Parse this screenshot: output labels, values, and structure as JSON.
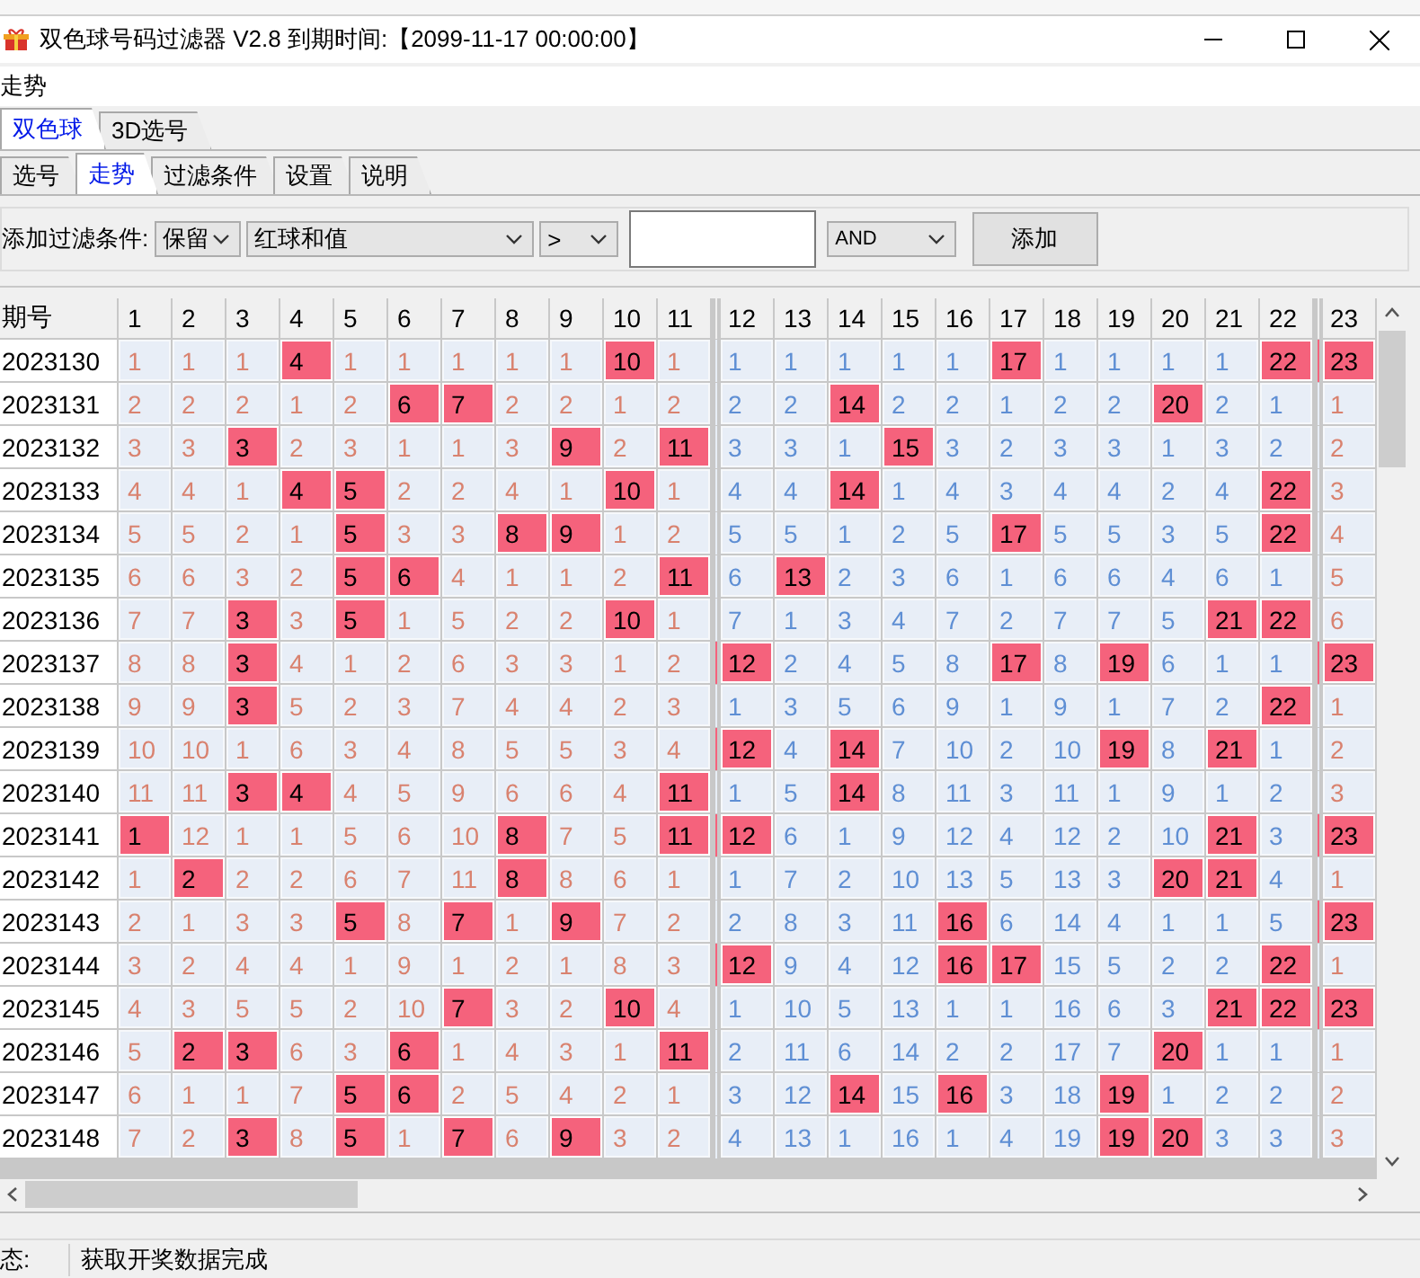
{
  "window": {
    "title": "双色球号码过滤器 V2.8 到期时间:【2099-11-17 00:00:00】"
  },
  "menu": [
    {
      "label": "走势"
    }
  ],
  "top_tabs": [
    {
      "label": "双色球",
      "selected": true
    },
    {
      "label": "3D选号",
      "selected": false
    }
  ],
  "sub_tabs": [
    {
      "label": "选号",
      "selected": false
    },
    {
      "label": "走势",
      "selected": true
    },
    {
      "label": "过滤条件",
      "selected": false
    },
    {
      "label": "设置",
      "selected": false
    },
    {
      "label": "说明",
      "selected": false
    }
  ],
  "filter": {
    "label": "添加过滤条件:",
    "action": "保留",
    "field": "红球和值",
    "operator": ">",
    "logic": "AND",
    "button": "添加"
  },
  "grid": {
    "period_header": "期号",
    "zones": [
      {
        "color": "#d9826f",
        "columns": [
          "1",
          "2",
          "3",
          "4",
          "5",
          "6",
          "7",
          "8",
          "9",
          "10",
          "11"
        ]
      },
      {
        "color": "#5f8fd4",
        "columns": [
          "12",
          "13",
          "14",
          "15",
          "16",
          "17",
          "18",
          "19",
          "20",
          "21",
          "22"
        ]
      },
      {
        "color": "#d9826f",
        "columns": [
          "23"
        ]
      }
    ],
    "rows": [
      {
        "period": "2023130",
        "values": [
          "1",
          "1",
          "1",
          "4",
          "1",
          "1",
          "1",
          "1",
          "1",
          "10",
          "1",
          "1",
          "1",
          "1",
          "1",
          "1",
          "17",
          "1",
          "1",
          "1",
          "1",
          "22",
          "23"
        ],
        "hit": [
          false,
          false,
          false,
          true,
          false,
          false,
          false,
          false,
          false,
          true,
          false,
          false,
          false,
          false,
          false,
          false,
          true,
          false,
          false,
          false,
          false,
          true,
          true
        ]
      },
      {
        "period": "2023131",
        "values": [
          "2",
          "2",
          "2",
          "1",
          "2",
          "6",
          "7",
          "2",
          "2",
          "1",
          "2",
          "2",
          "2",
          "14",
          "2",
          "2",
          "1",
          "2",
          "2",
          "20",
          "2",
          "1",
          "1"
        ],
        "hit": [
          false,
          false,
          false,
          false,
          false,
          true,
          true,
          false,
          false,
          false,
          false,
          false,
          false,
          true,
          false,
          false,
          false,
          false,
          false,
          true,
          false,
          false,
          false
        ]
      },
      {
        "period": "2023132",
        "values": [
          "3",
          "3",
          "3",
          "2",
          "3",
          "1",
          "1",
          "3",
          "9",
          "2",
          "11",
          "3",
          "3",
          "1",
          "15",
          "3",
          "2",
          "3",
          "3",
          "1",
          "3",
          "2",
          "2"
        ],
        "hit": [
          false,
          false,
          true,
          false,
          false,
          false,
          false,
          false,
          true,
          false,
          true,
          false,
          false,
          false,
          true,
          false,
          false,
          false,
          false,
          false,
          false,
          false,
          false
        ]
      },
      {
        "period": "2023133",
        "values": [
          "4",
          "4",
          "1",
          "4",
          "5",
          "2",
          "2",
          "4",
          "1",
          "10",
          "1",
          "4",
          "4",
          "14",
          "1",
          "4",
          "3",
          "4",
          "4",
          "2",
          "4",
          "22",
          "3"
        ],
        "hit": [
          false,
          false,
          false,
          true,
          true,
          false,
          false,
          false,
          false,
          true,
          false,
          false,
          false,
          true,
          false,
          false,
          false,
          false,
          false,
          false,
          false,
          true,
          false
        ]
      },
      {
        "period": "2023134",
        "values": [
          "5",
          "5",
          "2",
          "1",
          "5",
          "3",
          "3",
          "8",
          "9",
          "1",
          "2",
          "5",
          "5",
          "1",
          "2",
          "5",
          "17",
          "5",
          "5",
          "3",
          "5",
          "22",
          "4"
        ],
        "hit": [
          false,
          false,
          false,
          false,
          true,
          false,
          false,
          true,
          true,
          false,
          false,
          false,
          false,
          false,
          false,
          false,
          true,
          false,
          false,
          false,
          false,
          true,
          false
        ]
      },
      {
        "period": "2023135",
        "values": [
          "6",
          "6",
          "3",
          "2",
          "5",
          "6",
          "4",
          "1",
          "1",
          "2",
          "11",
          "6",
          "13",
          "2",
          "3",
          "6",
          "1",
          "6",
          "6",
          "4",
          "6",
          "1",
          "5"
        ],
        "hit": [
          false,
          false,
          false,
          false,
          true,
          true,
          false,
          false,
          false,
          false,
          true,
          false,
          true,
          false,
          false,
          false,
          false,
          false,
          false,
          false,
          false,
          false,
          false
        ]
      },
      {
        "period": "2023136",
        "values": [
          "7",
          "7",
          "3",
          "3",
          "5",
          "1",
          "5",
          "2",
          "2",
          "10",
          "1",
          "7",
          "1",
          "3",
          "4",
          "7",
          "2",
          "7",
          "7",
          "5",
          "21",
          "22",
          "6"
        ],
        "hit": [
          false,
          false,
          true,
          false,
          true,
          false,
          false,
          false,
          false,
          true,
          false,
          false,
          false,
          false,
          false,
          false,
          false,
          false,
          false,
          false,
          true,
          true,
          false
        ]
      },
      {
        "period": "2023137",
        "values": [
          "8",
          "8",
          "3",
          "4",
          "1",
          "2",
          "6",
          "3",
          "3",
          "1",
          "2",
          "12",
          "2",
          "4",
          "5",
          "8",
          "17",
          "8",
          "19",
          "6",
          "1",
          "1",
          "23"
        ],
        "hit": [
          false,
          false,
          true,
          false,
          false,
          false,
          false,
          false,
          false,
          false,
          false,
          true,
          false,
          false,
          false,
          false,
          true,
          false,
          true,
          false,
          false,
          false,
          true
        ]
      },
      {
        "period": "2023138",
        "values": [
          "9",
          "9",
          "3",
          "5",
          "2",
          "3",
          "7",
          "4",
          "4",
          "2",
          "3",
          "1",
          "3",
          "5",
          "6",
          "9",
          "1",
          "9",
          "1",
          "7",
          "2",
          "22",
          "1"
        ],
        "hit": [
          false,
          false,
          true,
          false,
          false,
          false,
          false,
          false,
          false,
          false,
          false,
          false,
          false,
          false,
          false,
          false,
          false,
          false,
          false,
          false,
          false,
          true,
          false
        ]
      },
      {
        "period": "2023139",
        "values": [
          "10",
          "10",
          "1",
          "6",
          "3",
          "4",
          "8",
          "5",
          "5",
          "3",
          "4",
          "12",
          "4",
          "14",
          "7",
          "10",
          "2",
          "10",
          "19",
          "8",
          "21",
          "1",
          "2"
        ],
        "hit": [
          false,
          false,
          false,
          false,
          false,
          false,
          false,
          false,
          false,
          false,
          false,
          true,
          false,
          true,
          false,
          false,
          false,
          false,
          true,
          false,
          true,
          false,
          false
        ]
      },
      {
        "period": "2023140",
        "values": [
          "11",
          "11",
          "3",
          "4",
          "4",
          "5",
          "9",
          "6",
          "6",
          "4",
          "11",
          "1",
          "5",
          "14",
          "8",
          "11",
          "3",
          "11",
          "1",
          "9",
          "1",
          "2",
          "3"
        ],
        "hit": [
          false,
          false,
          true,
          true,
          false,
          false,
          false,
          false,
          false,
          false,
          true,
          false,
          false,
          true,
          false,
          false,
          false,
          false,
          false,
          false,
          false,
          false,
          false
        ]
      },
      {
        "period": "2023141",
        "values": [
          "1",
          "12",
          "1",
          "1",
          "5",
          "6",
          "10",
          "8",
          "7",
          "5",
          "11",
          "12",
          "6",
          "1",
          "9",
          "12",
          "4",
          "12",
          "2",
          "10",
          "21",
          "3",
          "23"
        ],
        "hit": [
          true,
          false,
          false,
          false,
          false,
          false,
          false,
          true,
          false,
          false,
          true,
          true,
          false,
          false,
          false,
          false,
          false,
          false,
          false,
          false,
          true,
          false,
          true
        ]
      },
      {
        "period": "2023142",
        "values": [
          "1",
          "2",
          "2",
          "2",
          "6",
          "7",
          "11",
          "8",
          "8",
          "6",
          "1",
          "1",
          "7",
          "2",
          "10",
          "13",
          "5",
          "13",
          "3",
          "20",
          "21",
          "4",
          "1"
        ],
        "hit": [
          false,
          true,
          false,
          false,
          false,
          false,
          false,
          true,
          false,
          false,
          false,
          false,
          false,
          false,
          false,
          false,
          false,
          false,
          false,
          true,
          true,
          false,
          false
        ]
      },
      {
        "period": "2023143",
        "values": [
          "2",
          "1",
          "3",
          "3",
          "5",
          "8",
          "7",
          "1",
          "9",
          "7",
          "2",
          "2",
          "8",
          "3",
          "11",
          "16",
          "6",
          "14",
          "4",
          "1",
          "1",
          "5",
          "23"
        ],
        "hit": [
          false,
          false,
          false,
          false,
          true,
          false,
          true,
          false,
          true,
          false,
          false,
          false,
          false,
          false,
          false,
          true,
          false,
          false,
          false,
          false,
          false,
          false,
          true
        ]
      },
      {
        "period": "2023144",
        "values": [
          "3",
          "2",
          "4",
          "4",
          "1",
          "9",
          "1",
          "2",
          "1",
          "8",
          "3",
          "12",
          "9",
          "4",
          "12",
          "16",
          "17",
          "15",
          "5",
          "2",
          "2",
          "22",
          "1"
        ],
        "hit": [
          false,
          false,
          false,
          false,
          false,
          false,
          false,
          false,
          false,
          false,
          false,
          true,
          false,
          false,
          false,
          true,
          true,
          false,
          false,
          false,
          false,
          true,
          false
        ]
      },
      {
        "period": "2023145",
        "values": [
          "4",
          "3",
          "5",
          "5",
          "2",
          "10",
          "7",
          "3",
          "2",
          "10",
          "4",
          "1",
          "10",
          "5",
          "13",
          "1",
          "1",
          "16",
          "6",
          "3",
          "21",
          "22",
          "23"
        ],
        "hit": [
          false,
          false,
          false,
          false,
          false,
          false,
          true,
          false,
          false,
          true,
          false,
          false,
          false,
          false,
          false,
          false,
          false,
          false,
          false,
          false,
          true,
          true,
          true
        ]
      },
      {
        "period": "2023146",
        "values": [
          "5",
          "2",
          "3",
          "6",
          "3",
          "6",
          "1",
          "4",
          "3",
          "1",
          "11",
          "2",
          "11",
          "6",
          "14",
          "2",
          "2",
          "17",
          "7",
          "20",
          "1",
          "1",
          "1"
        ],
        "hit": [
          false,
          true,
          true,
          false,
          false,
          true,
          false,
          false,
          false,
          false,
          true,
          false,
          false,
          false,
          false,
          false,
          false,
          false,
          false,
          true,
          false,
          false,
          false
        ]
      },
      {
        "period": "2023147",
        "values": [
          "6",
          "1",
          "1",
          "7",
          "5",
          "6",
          "2",
          "5",
          "4",
          "2",
          "1",
          "3",
          "12",
          "14",
          "15",
          "16",
          "3",
          "18",
          "19",
          "1",
          "2",
          "2",
          "2"
        ],
        "hit": [
          false,
          false,
          false,
          false,
          true,
          true,
          false,
          false,
          false,
          false,
          false,
          false,
          false,
          true,
          false,
          true,
          false,
          false,
          true,
          false,
          false,
          false,
          false
        ]
      },
      {
        "period": "2023148",
        "values": [
          "7",
          "2",
          "3",
          "8",
          "5",
          "1",
          "7",
          "6",
          "9",
          "3",
          "2",
          "4",
          "13",
          "1",
          "16",
          "1",
          "4",
          "19",
          "19",
          "20",
          "3",
          "3",
          "3"
        ],
        "hit": [
          false,
          false,
          true,
          false,
          true,
          false,
          true,
          false,
          true,
          false,
          false,
          false,
          false,
          false,
          false,
          false,
          false,
          false,
          true,
          true,
          false,
          false,
          false
        ]
      }
    ]
  },
  "status_bar": {
    "label": "态:",
    "message": "获取开奖数据完成"
  }
}
